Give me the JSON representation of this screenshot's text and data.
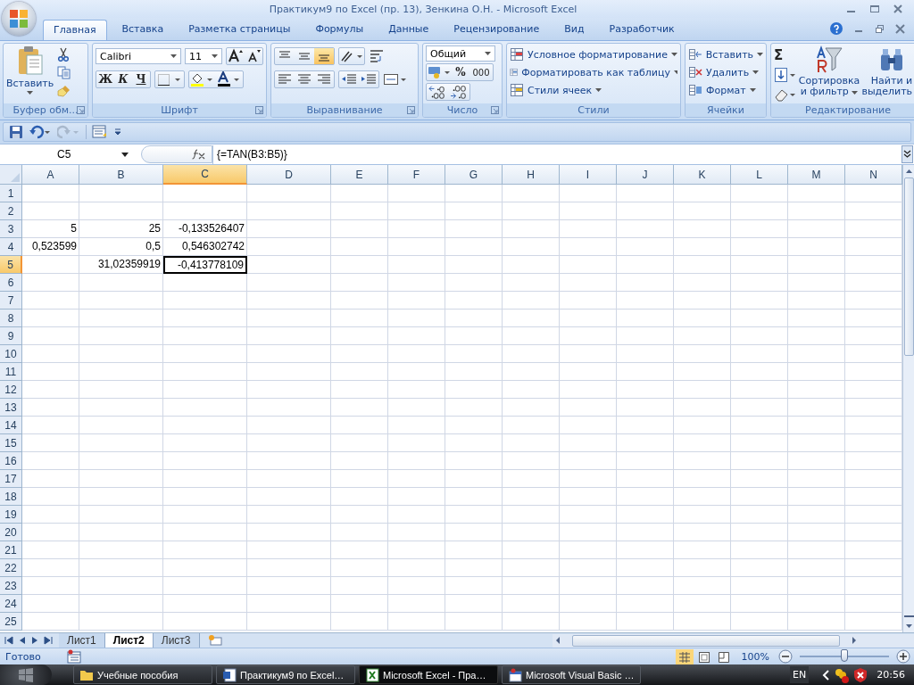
{
  "window": {
    "title": "Практикум9 по Excel (пр. 13), Зенкина О.Н. - Microsoft Excel"
  },
  "tabs": [
    {
      "label": "Главная",
      "selected": true
    },
    {
      "label": "Вставка",
      "selected": false
    },
    {
      "label": "Разметка страницы",
      "selected": false
    },
    {
      "label": "Формулы",
      "selected": false
    },
    {
      "label": "Данные",
      "selected": false
    },
    {
      "label": "Рецензирование",
      "selected": false
    },
    {
      "label": "Вид",
      "selected": false
    },
    {
      "label": "Разработчик",
      "selected": false
    }
  ],
  "ribbon": {
    "clipboard": {
      "paste": "Вставить",
      "label": "Буфер обм..."
    },
    "font": {
      "name": "Calibri",
      "size": "11",
      "bold": "Ж",
      "italic": "К",
      "underline": "Ч",
      "label": "Шрифт"
    },
    "alignment": {
      "vertical": [
        {
          "selected": false
        },
        {
          "selected": false
        },
        {
          "selected": true
        }
      ],
      "label": "Выравнивание"
    },
    "number": {
      "format": "Общий",
      "percent": "%",
      "thousands": "000",
      "label": "Число"
    },
    "styles": {
      "items": [
        "Условное форматирование",
        "Форматировать как таблицу",
        "Стили ячеек"
      ],
      "label": "Стили"
    },
    "cells": {
      "items": [
        "Вставить",
        "Удалить",
        "Формат"
      ],
      "label": "Ячейки"
    },
    "editing": {
      "sum": "Σ",
      "sort": "Сортировка и фильтр",
      "find": "Найти и выделить",
      "label": "Редактирование"
    }
  },
  "name_box": "C5",
  "formula": "{=TAN(B3:B5)}",
  "columns": [
    {
      "label": "A",
      "selected": false
    },
    {
      "label": "B",
      "selected": false
    },
    {
      "label": "C",
      "selected": true
    },
    {
      "label": "D",
      "selected": false
    },
    {
      "label": "E",
      "selected": false
    },
    {
      "label": "F",
      "selected": false
    },
    {
      "label": "G",
      "selected": false
    },
    {
      "label": "H",
      "selected": false
    },
    {
      "label": "I",
      "selected": false
    },
    {
      "label": "J",
      "selected": false
    },
    {
      "label": "K",
      "selected": false
    },
    {
      "label": "L",
      "selected": false
    },
    {
      "label": "M",
      "selected": false
    },
    {
      "label": "N",
      "selected": false
    }
  ],
  "rows": [
    {
      "number": "1",
      "selected": false
    },
    {
      "number": "2",
      "selected": false
    },
    {
      "number": "3",
      "selected": false,
      "cells": [
        {
          "value": "5",
          "selected": false
        },
        {
          "value": "25",
          "selected": false
        },
        {
          "value": "-0,133526407",
          "selected": false
        }
      ]
    },
    {
      "number": "4",
      "selected": false,
      "cells": [
        {
          "value": "0,523599",
          "selected": false
        },
        {
          "value": "0,5",
          "selected": false
        },
        {
          "value": "0,546302742",
          "selected": false
        }
      ]
    },
    {
      "number": "5",
      "selected": true,
      "cells": [
        {
          "selected": false
        },
        {
          "value": "31,02359919",
          "selected": false
        },
        {
          "value": "-0,413778109",
          "selected": true
        }
      ]
    },
    {
      "number": "6",
      "selected": false
    },
    {
      "number": "7",
      "selected": false
    },
    {
      "number": "8",
      "selected": false
    },
    {
      "number": "9",
      "selected": false
    },
    {
      "number": "10",
      "selected": false
    },
    {
      "number": "11",
      "selected": false
    },
    {
      "number": "12",
      "selected": false
    },
    {
      "number": "13",
      "selected": false
    },
    {
      "number": "14",
      "selected": false
    },
    {
      "number": "15",
      "selected": false
    },
    {
      "number": "16",
      "selected": false
    },
    {
      "number": "17",
      "selected": false
    },
    {
      "number": "18",
      "selected": false
    },
    {
      "number": "19",
      "selected": false
    },
    {
      "number": "20",
      "selected": false
    },
    {
      "number": "21",
      "selected": false
    },
    {
      "number": "22",
      "selected": false
    },
    {
      "number": "23",
      "selected": false
    },
    {
      "number": "24",
      "selected": false
    },
    {
      "number": "25",
      "selected": false
    }
  ],
  "sheets": [
    {
      "label": "Лист1",
      "selected": false
    },
    {
      "label": "Лист2",
      "selected": true
    },
    {
      "label": "Лист3",
      "selected": false
    }
  ],
  "status": "Готово",
  "zoom": {
    "label": "100%",
    "level": 0.5
  },
  "taskbar": {
    "items": [
      {
        "label": "Учебные пособия",
        "kind": "folder",
        "selected": false
      },
      {
        "label": "Практикум9 по Excel…",
        "kind": "word",
        "selected": false
      },
      {
        "label": "Microsoft Excel - Пра…",
        "kind": "excel",
        "selected": true
      },
      {
        "label": "Microsoft Visual Basic …",
        "kind": "vba",
        "selected": false
      }
    ],
    "language": "EN",
    "time": "20:56"
  }
}
